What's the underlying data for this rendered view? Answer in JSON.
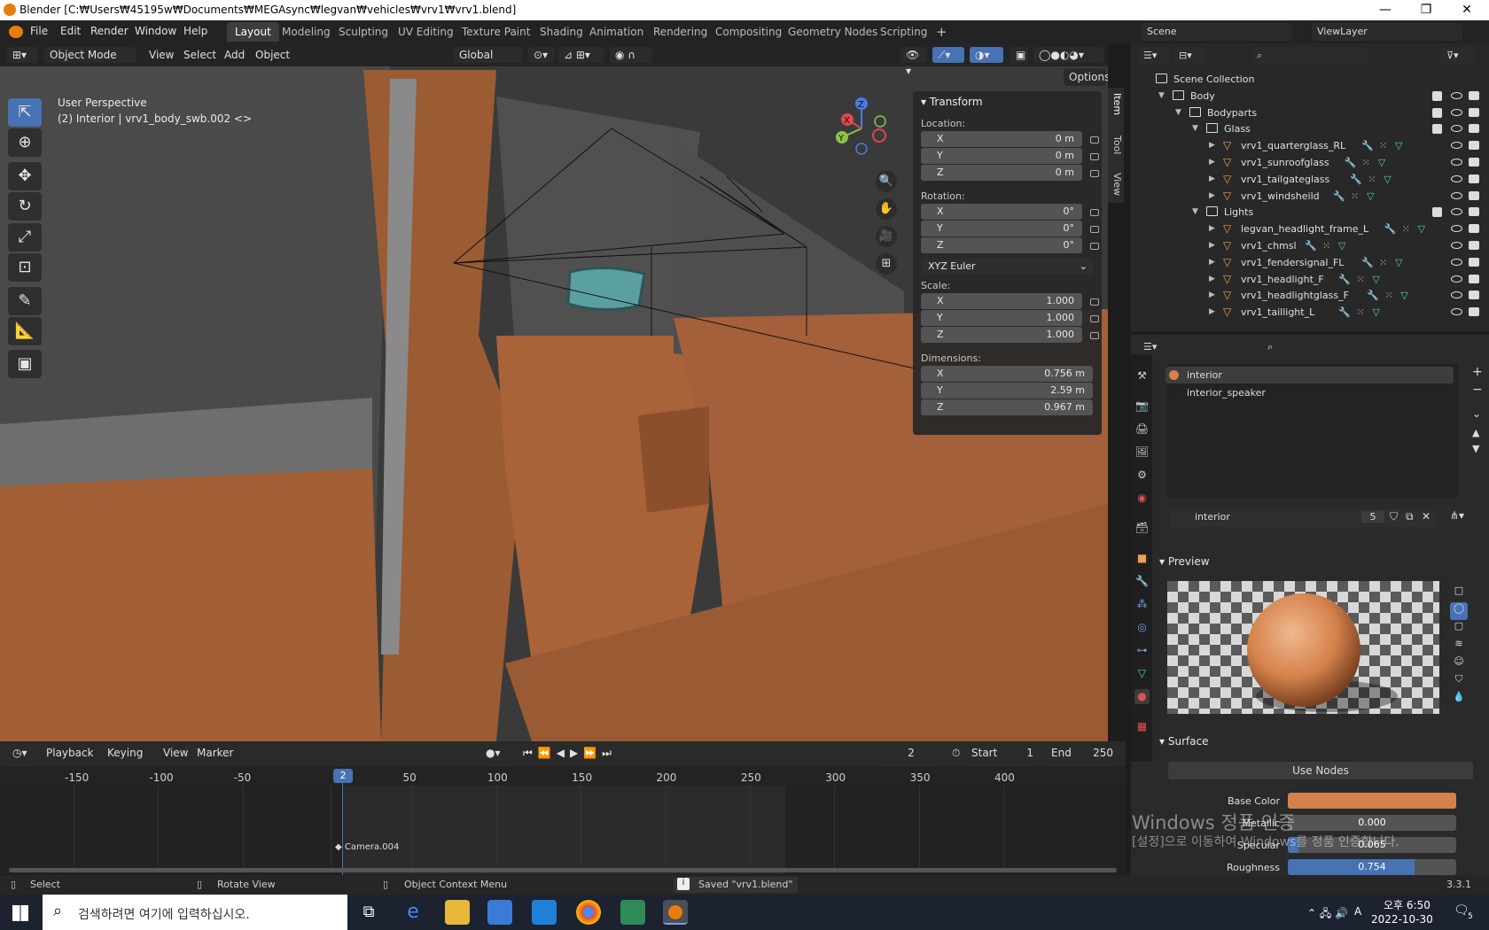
{
  "window": {
    "title": "Blender [C:₩Users₩45195w₩Documents₩MEGAsync₩legvan₩vehicles₩vrv1₩vrv1.blend]",
    "minimize": "—",
    "maximize": "❐",
    "close": "✕"
  },
  "menubar": {
    "items": [
      "File",
      "Edit",
      "Render",
      "Window",
      "Help"
    ],
    "workspaces": [
      "Layout",
      "Modeling",
      "Sculpting",
      "UV Editing",
      "Texture Paint",
      "Shading",
      "Animation",
      "Rendering",
      "Compositing",
      "Geometry Nodes",
      "Scripting"
    ],
    "active_workspace": "Layout",
    "add": "+",
    "scene": "Scene",
    "viewlayer": "ViewLayer"
  },
  "viewport": {
    "mode": "Object Mode",
    "menus": [
      "View",
      "Select",
      "Add",
      "Object"
    ],
    "orientation": "Global",
    "options": "Options",
    "overlay_title": "User Perspective",
    "overlay_subtitle": "(2) Interior | vrv1_body_swb.002 <>"
  },
  "transform": {
    "title": "Transform",
    "location_label": "Location:",
    "location": [
      {
        "axis": "X",
        "value": "0 m"
      },
      {
        "axis": "Y",
        "value": "0 m"
      },
      {
        "axis": "Z",
        "value": "0 m"
      }
    ],
    "rotation_label": "Rotation:",
    "rotation": [
      {
        "axis": "X",
        "value": "0°"
      },
      {
        "axis": "Y",
        "value": "0°"
      },
      {
        "axis": "Z",
        "value": "0°"
      }
    ],
    "rotation_mode": "XYZ Euler",
    "scale_label": "Scale:",
    "scale": [
      {
        "axis": "X",
        "value": "1.000"
      },
      {
        "axis": "Y",
        "value": "1.000"
      },
      {
        "axis": "Z",
        "value": "1.000"
      }
    ],
    "dimensions_label": "Dimensions:",
    "dimensions": [
      {
        "axis": "X",
        "value": "0.756 m"
      },
      {
        "axis": "Y",
        "value": "2.59 m"
      },
      {
        "axis": "Z",
        "value": "0.967 m"
      }
    ]
  },
  "ntabs": [
    "Item",
    "Tool",
    "View"
  ],
  "gizmo": {
    "x": "X",
    "y": "Y",
    "z": "Z"
  },
  "outliner": {
    "items": [
      {
        "label": "Scene Collection",
        "type": "scene"
      },
      {
        "label": "Body",
        "type": "coll"
      },
      {
        "label": "Bodyparts",
        "type": "coll"
      },
      {
        "label": "Glass",
        "type": "coll"
      },
      {
        "label": "vrv1_quarterglass_RL",
        "type": "obj"
      },
      {
        "label": "vrv1_sunroofglass",
        "type": "obj"
      },
      {
        "label": "vrv1_tailgateglass",
        "type": "obj"
      },
      {
        "label": "vrv1_windsheild",
        "type": "obj"
      },
      {
        "label": "Lights",
        "type": "coll"
      },
      {
        "label": "legvan_headlight_frame_L",
        "type": "obj"
      },
      {
        "label": "vrv1_chmsl",
        "type": "obj"
      },
      {
        "label": "vrv1_fendersignal_FL",
        "type": "obj"
      },
      {
        "label": "vrv1_headlight_F",
        "type": "obj"
      },
      {
        "label": "vrv1_headlightglass_F",
        "type": "obj"
      },
      {
        "label": "vrv1_taillight_L",
        "type": "obj"
      }
    ]
  },
  "material": {
    "slots": [
      "interior",
      "interior_speaker"
    ],
    "name": "interior",
    "users": "5",
    "preview": "Preview",
    "surface": "Surface",
    "use_nodes": "Use Nodes",
    "base_color_label": "Base Color",
    "base_color": "#d4824a",
    "metallic_label": "Metallic",
    "metallic": "0.000",
    "specular_label": "Specular",
    "specular": "0.065",
    "roughness_label": "Roughness",
    "roughness": "0.754",
    "roughness_fill": 0.754,
    "specular_fill": 0.065
  },
  "timeline": {
    "menus": [
      "Playback",
      "Keying",
      "View",
      "Marker"
    ],
    "frame": "2",
    "start_label": "Start",
    "start": "1",
    "end_label": "End",
    "end": "250",
    "ticks": [
      "-150",
      "-100",
      "-50",
      "2",
      "50",
      "100",
      "150",
      "200",
      "250",
      "300",
      "350",
      "400"
    ],
    "current": "2",
    "marker": "Camera.004"
  },
  "statusbar": {
    "select": "Select",
    "rotate": "Rotate View",
    "context": "Object Context Menu",
    "saved": "Saved \"vrv1.blend\"",
    "version": "3.3.1"
  },
  "watermark": {
    "line1": "Windows 정품 인증",
    "line2": "[설정]으로 이동하여 Windows를 정품 인증합니다."
  },
  "taskbar": {
    "search_placeholder": "검색하려면 여기에 입력하십시오.",
    "time": "오후 6:50",
    "date": "2022-10-30",
    "lang": "A",
    "notif": "5"
  }
}
